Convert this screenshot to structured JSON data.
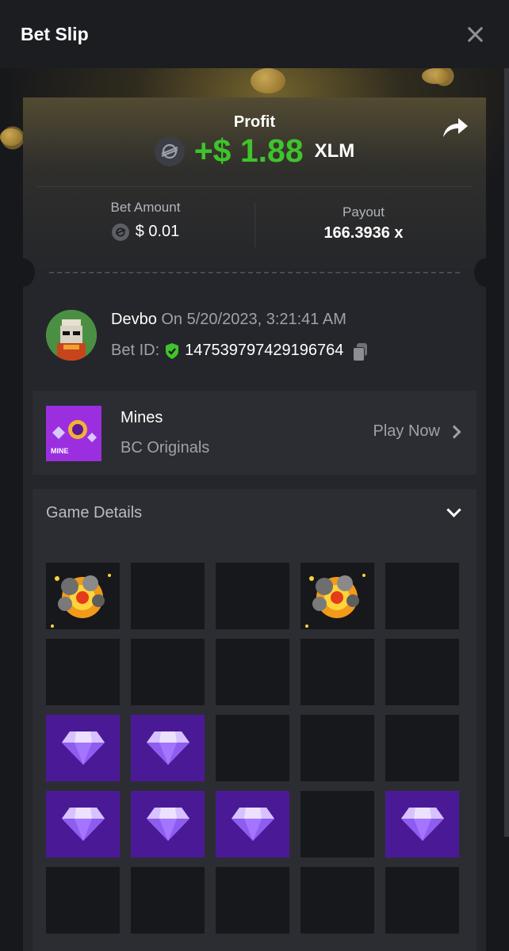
{
  "header": {
    "title": "Bet Slip"
  },
  "profit": {
    "label": "Profit",
    "amount": "+$ 1.88",
    "currency": "XLM",
    "currency_icon": "stellar-icon",
    "color": "#3fc42c"
  },
  "bet": {
    "bet_amount_label": "Bet Amount",
    "bet_amount_value": "$ 0.01",
    "payout_label": "Payout",
    "payout_value": "166.3936 x"
  },
  "user": {
    "name": "Devbo",
    "date_text": "On 5/20/2023, 3:21:41 AM",
    "bet_id_label": "Bet ID:",
    "bet_id": "147539797429196764"
  },
  "game": {
    "name": "Mines",
    "provider": "BC Originals",
    "play_label": "Play Now",
    "thumb_text": "MINE"
  },
  "details": {
    "title": "Game Details"
  },
  "board": {
    "tiles": [
      "mine",
      "empty",
      "empty",
      "mine",
      "empty",
      "empty",
      "empty",
      "empty",
      "empty",
      "empty",
      "gem",
      "gem",
      "empty",
      "empty",
      "empty",
      "gem",
      "gem",
      "gem",
      "empty",
      "gem",
      "empty",
      "empty",
      "empty",
      "empty",
      "empty"
    ]
  },
  "colors": {
    "gem_tile": "#4a1a96",
    "empty_tile": "#17181b",
    "panel": "#2c2d32"
  }
}
